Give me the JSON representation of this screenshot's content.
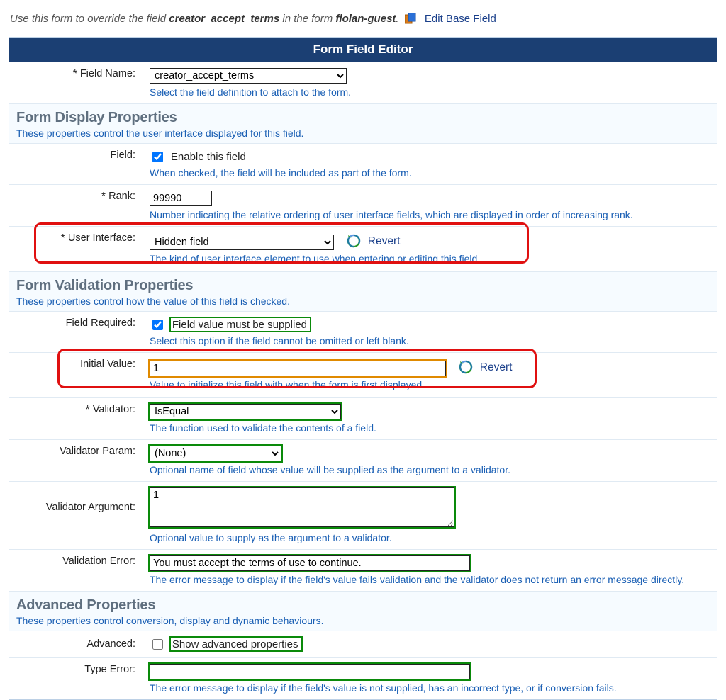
{
  "intro": {
    "prefix": "Use this form to override the field ",
    "field_name": "creator_accept_terms",
    "mid": " in the form ",
    "form_name": "flolan-guest",
    "suffix": ". "
  },
  "edit_base_link": "Edit Base Field",
  "panel_header": "Form Field Editor",
  "labels": {
    "field_name": "Field Name:",
    "field": "Field:",
    "rank": "Rank:",
    "user_interface": "User Interface:",
    "field_required": "Field Required:",
    "initial_value": "Initial Value:",
    "validator": "Validator:",
    "validator_param": "Validator Param:",
    "validator_argument": "Validator Argument:",
    "validation_error": "Validation Error:",
    "advanced": "Advanced:",
    "type_error": "Type Error:",
    "revert": "Revert"
  },
  "sections": {
    "display": {
      "title": "Form Display Properties",
      "sub": "These properties control the user interface displayed for this field."
    },
    "validation": {
      "title": "Form Validation Properties",
      "sub": "These properties control how the value of this field is checked."
    },
    "advanced": {
      "title": "Advanced Properties",
      "sub": "These properties control conversion, display and dynamic behaviours."
    }
  },
  "field_name": {
    "value": "creator_accept_terms",
    "hint": "Select the field definition to attach to the form."
  },
  "field_enable": {
    "checked": true,
    "label": "Enable this field",
    "hint": "When checked, the field will be included as part of the form."
  },
  "rank": {
    "value": "99990",
    "hint": "Number indicating the relative ordering of user interface fields, which are displayed in order of increasing rank."
  },
  "user_interface": {
    "value": "Hidden field",
    "hint": "The kind of user interface element to use when entering or editing this field."
  },
  "field_required": {
    "checked": true,
    "label": "Field value must be supplied",
    "hint": "Select this option if the field cannot be omitted or left blank."
  },
  "initial_value": {
    "value": "1",
    "hint": "Value to initialize this field with when the form is first displayed."
  },
  "validator": {
    "value": "IsEqual",
    "hint": "The function used to validate the contents of a field."
  },
  "validator_param": {
    "value": "(None)",
    "hint": "Optional name of field whose value will be supplied as the argument to a validator."
  },
  "validator_argument": {
    "value": "1",
    "hint": "Optional value to supply as the argument to a validator."
  },
  "validation_error": {
    "value": "You must accept the terms of use to continue.",
    "hint": "The error message to display if the field's value fails validation and the validator does not return an error message directly."
  },
  "advanced_cb": {
    "checked": false,
    "label": "Show advanced properties"
  },
  "type_error": {
    "value": "",
    "hint": "The error message to display if the field's value is not supplied, has an incorrect type, or if conversion fails."
  }
}
